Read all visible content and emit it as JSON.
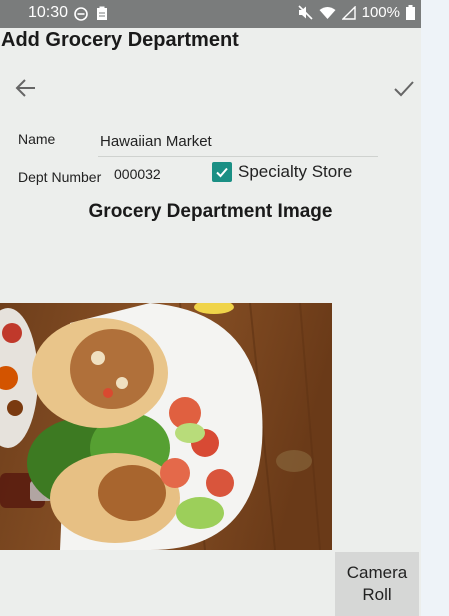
{
  "status_bar": {
    "time": "10:30",
    "battery": "100%",
    "icons": [
      "do-not-disturb-icon",
      "clipboard-icon",
      "mute-icon",
      "wifi-icon",
      "signal-icon",
      "battery-icon"
    ]
  },
  "header": {
    "title": "Add Grocery Department",
    "back_icon": "arrow-left-icon",
    "save_icon": "check-icon"
  },
  "form": {
    "name_label": "Name",
    "name_value": "Hawaiian Market",
    "dept_label": "Dept Number",
    "dept_value": "000032",
    "specialty_label": "Specialty Store",
    "specialty_checked": true
  },
  "image_section": {
    "heading": "Grocery Department Image",
    "image_icon": "food-photo-image"
  },
  "actions": {
    "camera_roll_label": "Camera\nRoll"
  },
  "colors": {
    "status_bar": "#7a7c7c",
    "background": "#eceeec",
    "accent": "#1a8f84",
    "button": "#d6d7d6"
  }
}
